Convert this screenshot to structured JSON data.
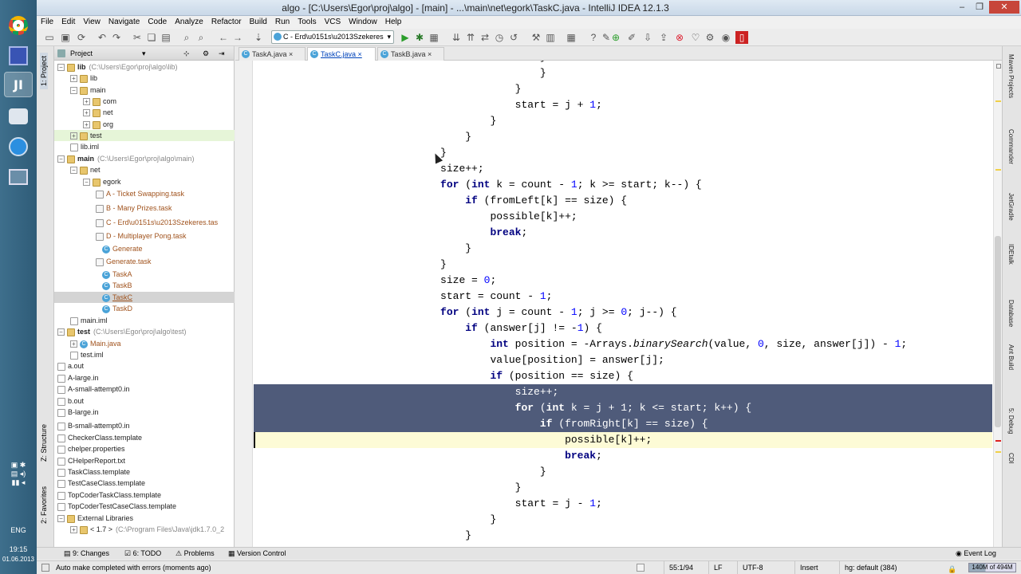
{
  "window": {
    "title": "algo - [C:\\Users\\Egor\\proj\\algo] - [main] - ...\\main\\net\\egork\\TaskC.java - IntelliJ IDEA 12.1.3"
  },
  "menu": [
    "File",
    "Edit",
    "View",
    "Navigate",
    "Code",
    "Analyze",
    "Refactor",
    "Build",
    "Run",
    "Tools",
    "VCS",
    "Window",
    "Help"
  ],
  "toolbar": {
    "run_config": "C - Erd\\u0151s\\u2013Szekeres"
  },
  "taskbar": {
    "lang": "ENG",
    "time": "19:15",
    "date": "01.06.2013"
  },
  "left_tools": {
    "project": "1: Project",
    "structure": "Z: Structure",
    "favorites": "2: Favorites"
  },
  "project": {
    "header": "Project",
    "tree": [
      {
        "label": "lib",
        "path": "(C:\\Users\\Egor\\proj\\algo\\lib)",
        "bold": true
      },
      {
        "label": "lib"
      },
      {
        "label": "main"
      },
      {
        "label": "com"
      },
      {
        "label": "net"
      },
      {
        "label": "org"
      },
      {
        "label": "test"
      },
      {
        "label": "lib.iml"
      },
      {
        "label": "main",
        "path": "(C:\\Users\\Egor\\proj\\algo\\main)",
        "bold": true
      },
      {
        "label": "net"
      },
      {
        "label": "egork"
      },
      {
        "label": "A - Ticket Swapping.task"
      },
      {
        "label": "B - Many Prizes.task"
      },
      {
        "label": "C - Erd\\u0151s\\u2013Szekeres.tas"
      },
      {
        "label": "D - Multiplayer Pong.task"
      },
      {
        "label": "Generate"
      },
      {
        "label": "Generate.task"
      },
      {
        "label": "TaskA"
      },
      {
        "label": "TaskB"
      },
      {
        "label": "TaskC"
      },
      {
        "label": "TaskD"
      },
      {
        "label": "main.iml"
      },
      {
        "label": "test",
        "path": "(C:\\Users\\Egor\\proj\\algo\\test)",
        "bold": true
      },
      {
        "label": "Main.java"
      },
      {
        "label": "test.iml"
      },
      {
        "label": "a.out"
      },
      {
        "label": "A-large.in"
      },
      {
        "label": "A-small-attempt0.in"
      },
      {
        "label": "b.out"
      },
      {
        "label": "B-large.in"
      },
      {
        "label": "B-small-attempt0.in"
      },
      {
        "label": "CheckerClass.template"
      },
      {
        "label": "chelper.properties"
      },
      {
        "label": "CHelperReport.txt"
      },
      {
        "label": "TaskClass.template"
      },
      {
        "label": "TestCaseClass.template"
      },
      {
        "label": "TopCoderTaskClass.template"
      },
      {
        "label": "TopCoderTestCaseClass.template"
      },
      {
        "label": "External Libraries"
      },
      {
        "label": "< 1.7 >",
        "path": "(C:\\Program Files\\Java\\jdk1.7.0_2"
      }
    ]
  },
  "editor": {
    "tabs": [
      "TaskA.java",
      "TaskC.java",
      "TaskB.java"
    ],
    "active_tab": "TaskC.java"
  },
  "right_tools": [
    "Maven Projects",
    "Commander",
    "JetGradle",
    "IDEtalk",
    "Database",
    "Ant Build",
    "5: Debug",
    "CDI"
  ],
  "bottom_tools": {
    "changes": "9: Changes",
    "todo": "6: TODO",
    "problems": "Problems",
    "vcs": "Version Control",
    "event_log": "Event Log"
  },
  "status": {
    "message": "Auto make completed with errors (moments ago)",
    "position": "55:1/94",
    "line_sep": "LF",
    "encoding": "UTF-8",
    "mode": "Insert",
    "vcs": "hg: default (384)",
    "memory": "140M of 494M"
  },
  "colors": {
    "selection": "#4f5b7a",
    "current_line": "#fdfbd6",
    "keyword": "#000080",
    "number": "#0000ff"
  }
}
